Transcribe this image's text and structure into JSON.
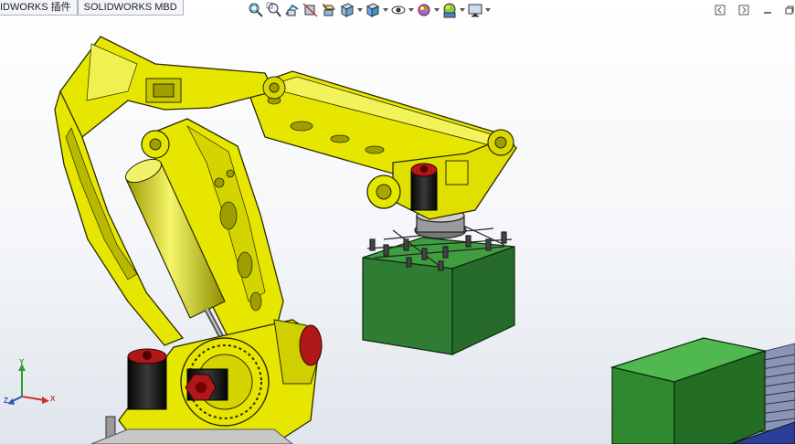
{
  "tabs": [
    {
      "label": "IDWORKS 插件"
    },
    {
      "label": "SOLIDWORKS MBD"
    }
  ],
  "toolbar": {
    "items": [
      {
        "icon": "zoom-to-fit-icon",
        "dropdown": false
      },
      {
        "icon": "zoom-to-area-icon",
        "dropdown": false
      },
      {
        "icon": "previous-view-icon",
        "dropdown": false
      },
      {
        "icon": "section-view-icon",
        "dropdown": false
      },
      {
        "icon": "dynamic-annotation-view-icon",
        "dropdown": false
      },
      {
        "icon": "view-orientation-icon",
        "dropdown": true
      },
      {
        "icon": "display-style-icon",
        "dropdown": true
      },
      {
        "icon": "hide-show-items-icon",
        "dropdown": true
      },
      {
        "icon": "edit-appearance-icon",
        "dropdown": true
      },
      {
        "icon": "apply-scene-icon",
        "dropdown": true
      },
      {
        "icon": "view-settings-icon",
        "dropdown": true
      }
    ]
  },
  "window": {
    "restore_icon": "restore-window-icon",
    "close_icon": "close-window-icon",
    "minimize_icon": "minimize-window-icon",
    "maximize_icon": "maximize-window-icon"
  },
  "triad": {
    "x_label": "X",
    "y_label": "Y",
    "z_label": "Z",
    "x_color": "#d03030",
    "y_color": "#2f9a2f",
    "z_color": "#2f52b8"
  },
  "colors": {
    "robot_yellow": "#e6e600",
    "box_green": "#2e7d32",
    "motor_red": "#b01818",
    "conveyor_blue": "#2a3f9a"
  }
}
